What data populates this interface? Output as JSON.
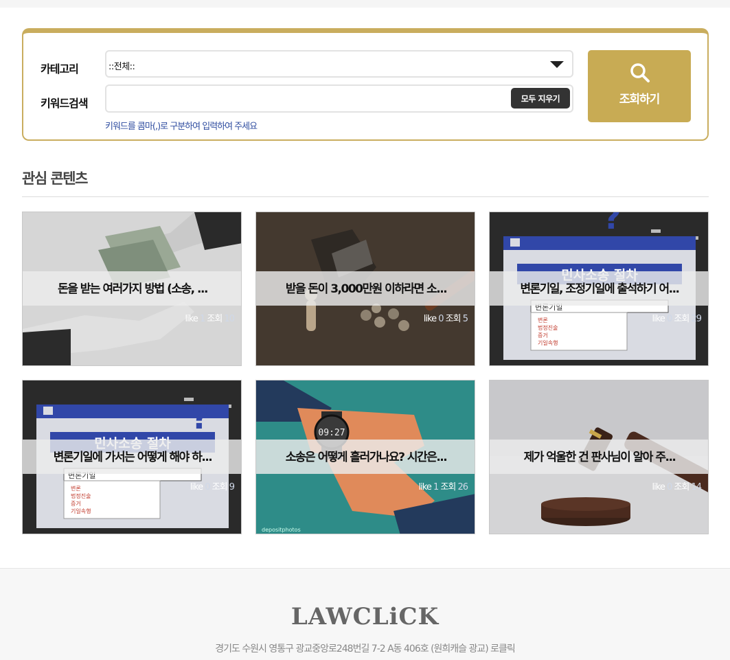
{
  "search": {
    "category_label": "카테고리",
    "category_value": "::전체::",
    "keyword_label": "키워드검색",
    "keyword_value": "",
    "clear_label": "모두 지우기",
    "hint": "키워드를 콤마(,)로 구분하여 입력하여 주세요",
    "button_label": "조회하기",
    "button_icon": "search-icon",
    "accent_color": "#c8ab54"
  },
  "section": {
    "title": "관심 콘텐츠"
  },
  "cards": [
    {
      "title": "돈을 받는 여러가지 방법 (소송, ...",
      "like_label": "like",
      "likes": "1",
      "view_label": "조회",
      "views": "10"
    },
    {
      "title": "받을 돈이 3,000만원 이하라면 소...",
      "like_label": "like",
      "likes": "0",
      "view_label": "조회",
      "views": "5"
    },
    {
      "title": "변론기일, 조정기일에 출석하기 어...",
      "like_label": "like",
      "likes": "0",
      "view_label": "조회",
      "views": "29"
    },
    {
      "title": "변론기일에 가서는 어떻게 해야 하...",
      "like_label": "like",
      "likes": "0",
      "view_label": "조회",
      "views": "9"
    },
    {
      "title": "소송은 어떻게 흘러가나요? 시간은...",
      "like_label": "like",
      "likes": "1",
      "view_label": "조회",
      "views": "26"
    },
    {
      "title": "제가 억울한 건 판사님이 알아 주...",
      "like_label": "like",
      "likes": "0",
      "view_label": "조회",
      "views": "14"
    }
  ],
  "card_images": {
    "poster_header": "민사소송 절차",
    "poster_field": "변론기일",
    "poster_items": [
      "변론",
      "법정진술",
      "증거",
      "기일속행"
    ],
    "watch_time": "09:27",
    "watch_credit": "depositphotos"
  },
  "footer": {
    "logo": "LAWCLiCK",
    "address": "경기도 수원시 영통구 광교중앙로248번길 7-2 A동 406호 (원희캐슬 광교) 로클릭"
  }
}
